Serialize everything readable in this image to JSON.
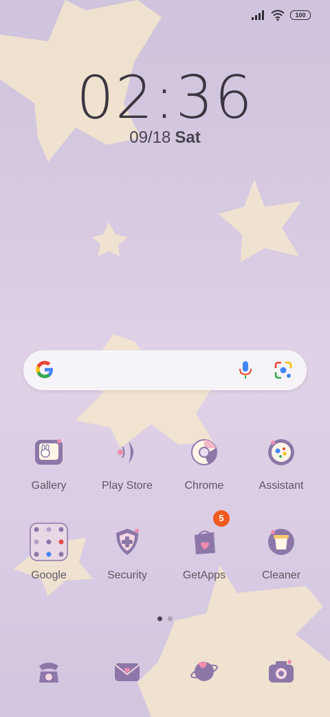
{
  "status_bar": {
    "battery": "100",
    "signal_icon": "signal-icon",
    "wifi_icon": "wifi-icon"
  },
  "clock": {
    "time": "02:36",
    "date": "09/18",
    "day": "Sat"
  },
  "search_bar": {
    "logo": "google-g-icon",
    "mic_icon": "mic-icon",
    "lens_icon": "lens-icon"
  },
  "apps_row1": [
    {
      "label": "Gallery"
    },
    {
      "label": "Play Store"
    },
    {
      "label": "Chrome"
    },
    {
      "label": "Assistant"
    }
  ],
  "apps_row2": [
    {
      "label": "Google"
    },
    {
      "label": "Security"
    },
    {
      "label": "GetApps",
      "badge": "5"
    },
    {
      "label": "Cleaner"
    }
  ],
  "page_indicator": {
    "pages": 2,
    "current": 1
  },
  "dock": [
    {
      "icon": "phone-icon"
    },
    {
      "icon": "messages-icon"
    },
    {
      "icon": "browser-icon"
    },
    {
      "icon": "camera-icon"
    }
  ],
  "colors": {
    "star": "#f3e6cc",
    "icon_purple": "#8c77a8",
    "badge": "#f05a1f"
  }
}
